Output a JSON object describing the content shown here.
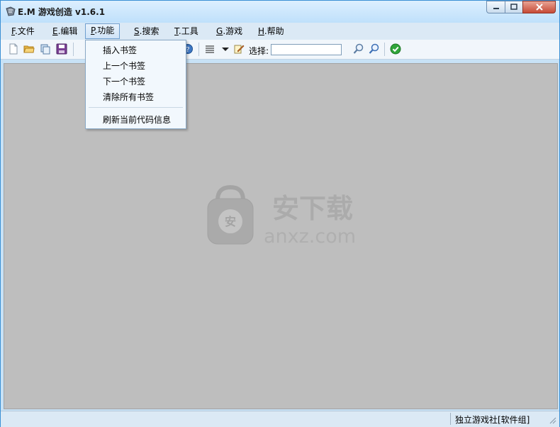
{
  "window": {
    "title": "E.M 游戏创造 v1.6.1"
  },
  "menubar": [
    {
      "key": "F",
      "label": ".文件"
    },
    {
      "key": "E",
      "label": ".编辑"
    },
    {
      "key": "P",
      "label": ".功能"
    },
    {
      "key": "S",
      "label": ".搜索"
    },
    {
      "key": "T",
      "label": ".工具"
    },
    {
      "key": "G",
      "label": ".游戏"
    },
    {
      "key": "H",
      "label": ".帮助"
    }
  ],
  "dropdown": {
    "items": [
      "插入书签",
      "上一个书签",
      "下一个书签",
      "清除所有书签"
    ],
    "after_separator": [
      "刷新当前代码信息"
    ]
  },
  "toolbar": {
    "select_label": "选择:",
    "select_value": ""
  },
  "watermark": {
    "logo_text": "安下载",
    "domain": "anxz.com",
    "badge": "安"
  },
  "status": {
    "text": "独立游戏社[软件组]"
  },
  "colors": {
    "title_bar": "#c8e2f6",
    "workspace": "#bebebe",
    "accent": "#3a8fd4",
    "close_button": "#c74a36"
  },
  "icons": [
    "app-icon",
    "new-file-icon",
    "open-folder-icon",
    "copy-icon",
    "save-icon",
    "help-icon",
    "text-format-icon",
    "dropdown-arrow-icon",
    "edit-icon",
    "search-icon",
    "search-next-icon",
    "ok-check-icon"
  ]
}
